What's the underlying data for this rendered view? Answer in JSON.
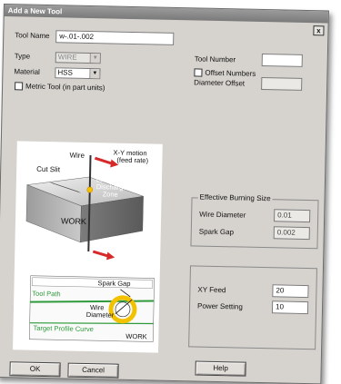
{
  "window": {
    "title": "Add a New Tool",
    "close_label": "x"
  },
  "fields": {
    "tool_name_label": "Tool Name",
    "tool_name_value": "w-.01-.002",
    "type_label": "Type",
    "type_value": "WIRE",
    "material_label": "Material",
    "material_value": "HSS",
    "metric_label": "Metric Tool (in part units)",
    "tool_number_label": "Tool Number",
    "tool_number_value": "",
    "offset_numbers_label": "Offset Numbers",
    "diameter_offset_label": "Diameter Offset",
    "diameter_offset_value": ""
  },
  "burning": {
    "title": "Effective Burning Size",
    "wire_diameter_label": "Wire Diameter",
    "wire_diameter_value": "0.01",
    "spark_gap_label": "Spark Gap",
    "spark_gap_value": "0.002"
  },
  "feed": {
    "xy_feed_label": "XY Feed",
    "xy_feed_value": "20",
    "power_label": "Power Setting",
    "power_value": "10"
  },
  "diagram": {
    "wire": "Wire",
    "motion_1": "X-Y motion",
    "motion_2": "(feed rate)",
    "cut_slit": "Cut Slit",
    "edz_1": "Electrical",
    "edz_2": "Discharge",
    "edz_3": "Zone",
    "work": "WORK",
    "spark_gap": "Spark Gap",
    "tool_path": "Tool Path",
    "wire_diam_1": "Wire",
    "wire_diam_2": "Diameter",
    "target_curve": "Target Profile Curve",
    "work_bottom": "WORK"
  },
  "buttons": {
    "ok": "OK",
    "cancel": "Cancel",
    "help": "Help"
  },
  "colors": {
    "accent_red": "#d62a2a",
    "tool_path_green": "#2e9a3b",
    "wire_yellow": "#f2c200"
  }
}
